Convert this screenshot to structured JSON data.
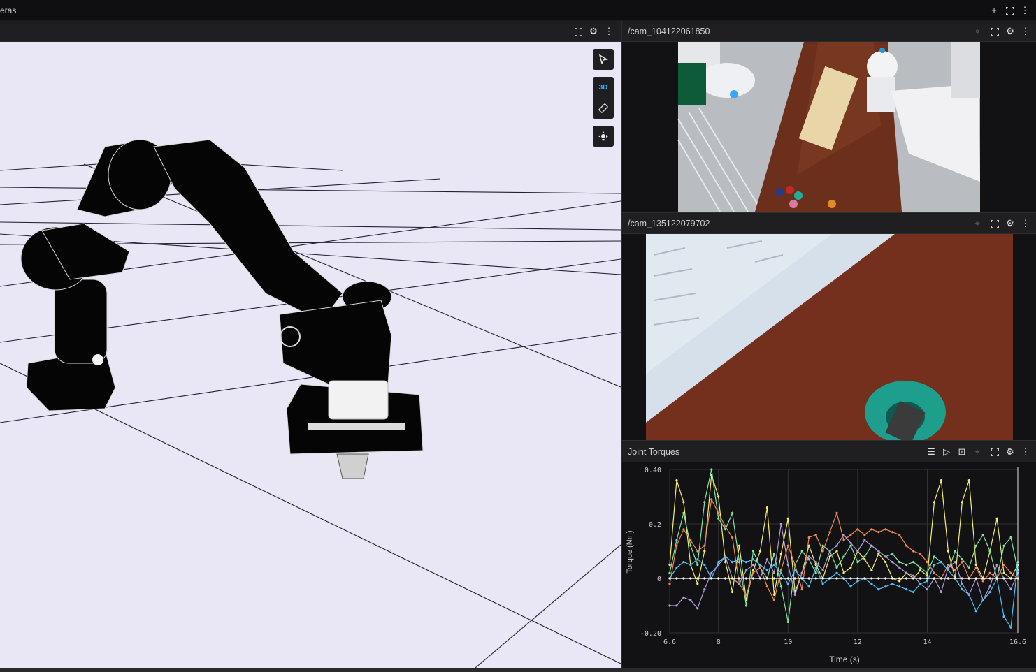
{
  "app": {
    "window_title": "eras"
  },
  "toolbar_icons": [
    "plus-icon",
    "fullscreen-icon",
    "more-vert-icon"
  ],
  "viewport": {
    "tools": {
      "select_icon": "cursor-icon",
      "mode_label": "3D",
      "measure_icon": "ruler-icon",
      "orbit_icon": "orbit-icon"
    }
  },
  "panels": {
    "cam1": {
      "title": "/cam_104122061850"
    },
    "cam2": {
      "title": "/cam_135122079702"
    },
    "plot": {
      "title": "Joint Torques"
    }
  },
  "colors": {
    "accent": "#29b6f6",
    "panel_bg": "#1f1f22",
    "viewport_bg": "#e9e6f5",
    "series": [
      "#f7ef6a",
      "#7fe8a2",
      "#f08a4b",
      "#b39ddb",
      "#4fc3f7",
      "#ffffff"
    ]
  },
  "chart_data": {
    "type": "line",
    "title": "",
    "xlabel": "Time (s)",
    "ylabel": "Torque (Nm)",
    "xlim": [
      6.6,
      16.6
    ],
    "ylim": [
      -0.2,
      0.4
    ],
    "x_ticks": [
      "6.6",
      "8",
      "10",
      "12",
      "14",
      "16.6"
    ],
    "y_ticks": [
      "0.40",
      "0.2",
      "0",
      "-0.20"
    ],
    "x": [
      6.6,
      6.8,
      7.0,
      7.2,
      7.4,
      7.6,
      7.8,
      8.0,
      8.2,
      8.4,
      8.6,
      8.8,
      9.0,
      9.2,
      9.4,
      9.6,
      9.8,
      10.0,
      10.2,
      10.4,
      10.6,
      10.8,
      11.0,
      11.2,
      11.4,
      11.6,
      11.8,
      12.0,
      12.2,
      12.4,
      12.6,
      12.8,
      13.0,
      13.2,
      13.4,
      13.6,
      13.8,
      14.0,
      14.2,
      14.4,
      14.6,
      14.8,
      15.0,
      15.2,
      15.4,
      15.6,
      15.8,
      16.0,
      16.2,
      16.4,
      16.6
    ],
    "series": [
      {
        "values": [
          0.05,
          0.36,
          0.28,
          0.05,
          -0.02,
          0.1,
          0.38,
          0.3,
          0.06,
          -0.05,
          0.12,
          -0.08,
          0.03,
          0.1,
          0.26,
          -0.06,
          0.09,
          0.22,
          -0.05,
          0.02,
          0.12,
          0.05,
          0.0,
          0.08,
          0.1,
          0.02,
          0.04,
          0.1,
          0.07,
          0.03,
          0.09,
          0.06,
          0.0,
          -0.01,
          0.02,
          0.0,
          0.03,
          0.01,
          0.28,
          0.36,
          0.1,
          0.0,
          0.28,
          0.36,
          0.05,
          0.0,
          0.1,
          0.22,
          0.02,
          0.0,
          0.05
        ]
      },
      {
        "values": [
          0.02,
          0.14,
          0.24,
          0.12,
          0.05,
          0.28,
          0.4,
          0.22,
          0.18,
          0.24,
          0.06,
          -0.1,
          0.1,
          0.04,
          0.0,
          0.09,
          -0.03,
          -0.16,
          0.05,
          0.1,
          0.07,
          0.02,
          0.12,
          0.1,
          0.04,
          0.08,
          0.12,
          0.06,
          0.08,
          0.12,
          0.1,
          0.08,
          0.09,
          0.06,
          0.05,
          0.06,
          0.04,
          0.02,
          0.08,
          0.06,
          0.03,
          0.1,
          0.07,
          0.04,
          0.12,
          0.16,
          0.1,
          0.0,
          0.12,
          0.15,
          0.03
        ]
      },
      {
        "values": [
          -0.02,
          0.12,
          0.18,
          0.14,
          0.1,
          0.12,
          0.29,
          0.24,
          0.19,
          0.15,
          -0.02,
          -0.06,
          0.02,
          0.04,
          -0.03,
          -0.08,
          0.03,
          0.12,
          0.05,
          -0.04,
          0.15,
          0.16,
          0.1,
          0.17,
          0.24,
          0.14,
          0.16,
          0.18,
          0.16,
          0.18,
          0.17,
          0.18,
          0.17,
          0.16,
          0.12,
          0.1,
          0.09,
          0.06,
          0.02,
          0.0,
          0.05,
          0.03,
          0.06,
          0.0,
          0.04,
          -0.01,
          0.02,
          0.0,
          0.05,
          0.02,
          0.0
        ]
      },
      {
        "values": [
          -0.1,
          -0.1,
          -0.07,
          -0.08,
          -0.11,
          -0.04,
          0.02,
          0.05,
          0.08,
          0.0,
          -0.02,
          0.03,
          0.05,
          0.0,
          0.07,
          0.02,
          0.2,
          0.05,
          -0.06,
          0.02,
          0.08,
          0.06,
          0.03,
          0.1,
          0.12,
          0.16,
          0.13,
          0.1,
          0.14,
          0.12,
          0.1,
          0.08,
          0.06,
          0.04,
          0.02,
          0.01,
          -0.02,
          -0.04,
          0.0,
          -0.05,
          0.04,
          0.06,
          -0.02,
          -0.06,
          0.0,
          -0.08,
          -0.03,
          0.05,
          0.0,
          -0.04,
          0.02
        ]
      },
      {
        "values": [
          0.0,
          0.04,
          0.06,
          0.05,
          0.07,
          0.05,
          0.0,
          0.06,
          0.08,
          0.06,
          0.07,
          0.06,
          0.07,
          0.05,
          0.03,
          0.05,
          0.02,
          -0.02,
          0.03,
          0.0,
          -0.03,
          0.04,
          -0.02,
          0.0,
          0.02,
          0.0,
          -0.03,
          -0.01,
          0.0,
          -0.02,
          -0.04,
          -0.03,
          -0.02,
          -0.03,
          -0.04,
          -0.05,
          -0.02,
          -0.01,
          0.05,
          0.06,
          0.03,
          0.0,
          -0.04,
          -0.06,
          -0.12,
          -0.08,
          -0.05,
          0.0,
          -0.14,
          -0.18,
          0.06
        ]
      },
      {
        "values": [
          0.0,
          0.0,
          0.0,
          0.0,
          0.0,
          0.0,
          0.0,
          0.0,
          0.0,
          0.0,
          0.0,
          0.0,
          0.0,
          0.0,
          0.0,
          0.0,
          0.0,
          0.0,
          0.0,
          0.0,
          0.0,
          0.0,
          0.0,
          0.0,
          0.0,
          0.0,
          0.0,
          0.0,
          0.0,
          0.0,
          0.0,
          0.0,
          0.0,
          0.0,
          0.0,
          0.0,
          0.0,
          0.0,
          0.0,
          0.0,
          0.0,
          0.0,
          0.0,
          0.0,
          0.0,
          0.0,
          0.0,
          0.0,
          0.0,
          0.0,
          0.0
        ]
      }
    ],
    "grid": true,
    "legend": "none"
  }
}
